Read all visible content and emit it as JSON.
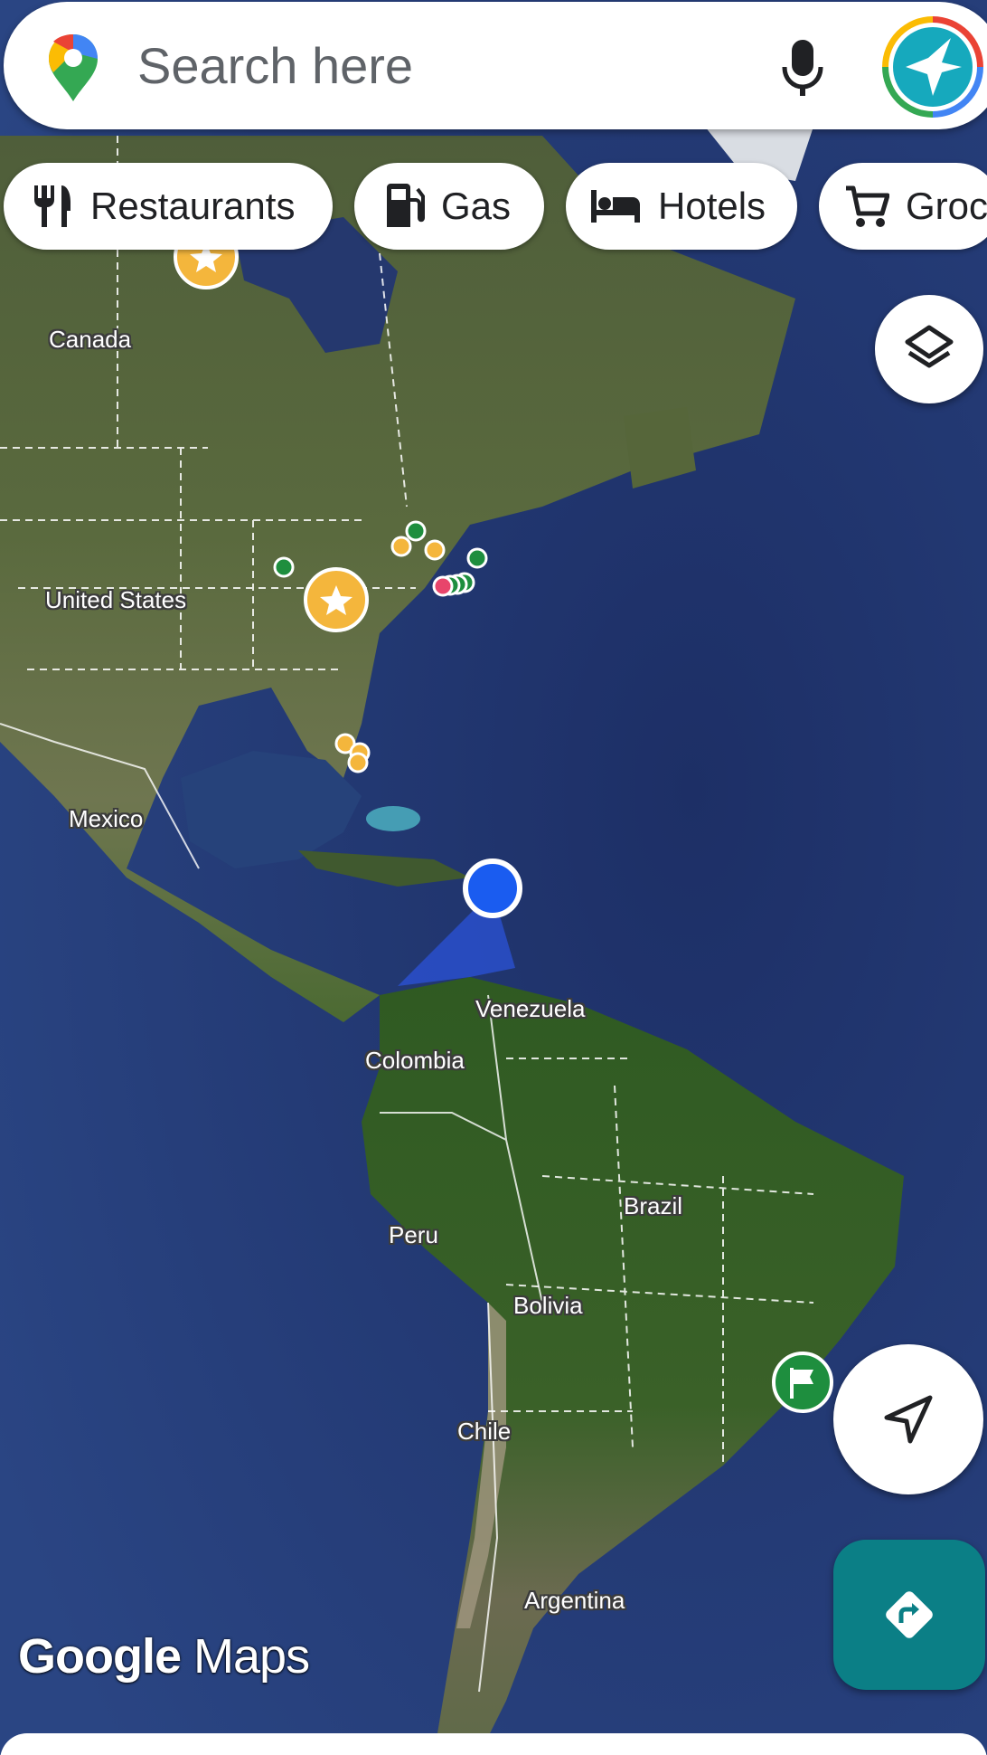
{
  "search": {
    "placeholder": "Search here"
  },
  "chips": [
    {
      "label": "Restaurants",
      "icon": "restaurant-icon"
    },
    {
      "label": "Gas",
      "icon": "gas-station-icon"
    },
    {
      "label": "Hotels",
      "icon": "hotel-bed-icon"
    },
    {
      "label": "Groc",
      "icon": "grocery-cart-icon"
    }
  ],
  "map": {
    "view": "satellite",
    "labels": {
      "canada": "Canada",
      "united_states": "United States",
      "mexico": "Mexico",
      "venezuela": "Venezuela",
      "colombia": "Colombia",
      "brazil": "Brazil",
      "peru": "Peru",
      "bolivia": "Bolivia",
      "chile": "Chile",
      "argentina": "Argentina"
    },
    "markers": {
      "starred_place": "star-icon",
      "saved_flag": "flag-icon",
      "current_location": "blue-dot"
    }
  },
  "watermark": {
    "google": "Google",
    "maps": "Maps"
  },
  "colors": {
    "ocean": "#233a72",
    "land": "#3d5a2a",
    "location_blue": "#1a5cf0",
    "star_marker": "#f4b63c",
    "green_marker": "#1e8e3e",
    "directions_button": "#0b7f86"
  }
}
